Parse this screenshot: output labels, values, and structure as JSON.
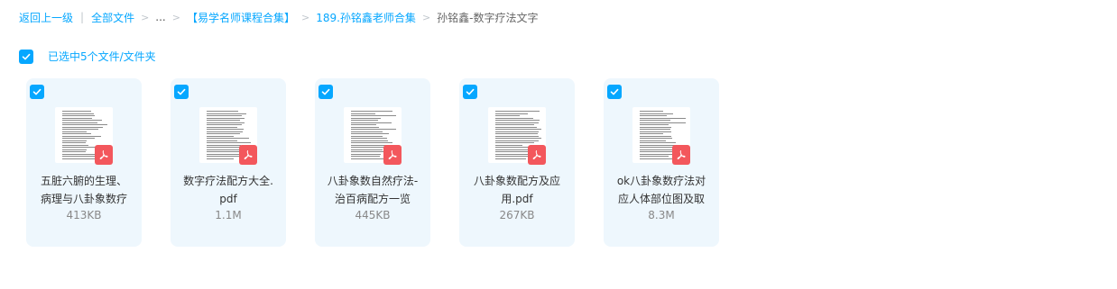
{
  "breadcrumb": {
    "back": "返回上一级",
    "all_files": "全部文件",
    "ellipsis": "...",
    "folder1": "【易学名师课程合集】",
    "folder2": "189.孙铭鑫老师合集",
    "current": "孙铭鑫-数字疗法文字"
  },
  "selection": {
    "label": "已选中5个文件/文件夹"
  },
  "files": [
    {
      "line1": "五脏六腑的生理、",
      "line2": "病理与八卦象数疗",
      "size": "413KB",
      "icon": "pdf-icon",
      "checked": true
    },
    {
      "line1": "数字疗法配方大全.",
      "line2": "pdf",
      "size": "1.1M",
      "icon": "pdf-icon",
      "checked": true
    },
    {
      "line1": "八卦象数自然疗法-",
      "line2": "治百病配方一览",
      "size": "445KB",
      "icon": "pdf-icon",
      "checked": true
    },
    {
      "line1": "八卦象数配方及应",
      "line2": "用.pdf",
      "size": "267KB",
      "icon": "pdf-icon",
      "checked": true
    },
    {
      "line1": "ok八卦象数疗法对",
      "line2": "应人体部位图及取",
      "size": "8.3M",
      "icon": "pdf-icon",
      "checked": true
    }
  ],
  "colors": {
    "accent": "#06a7ff",
    "pdf_red": "#f3575c",
    "card_bg": "#eef7fd"
  }
}
